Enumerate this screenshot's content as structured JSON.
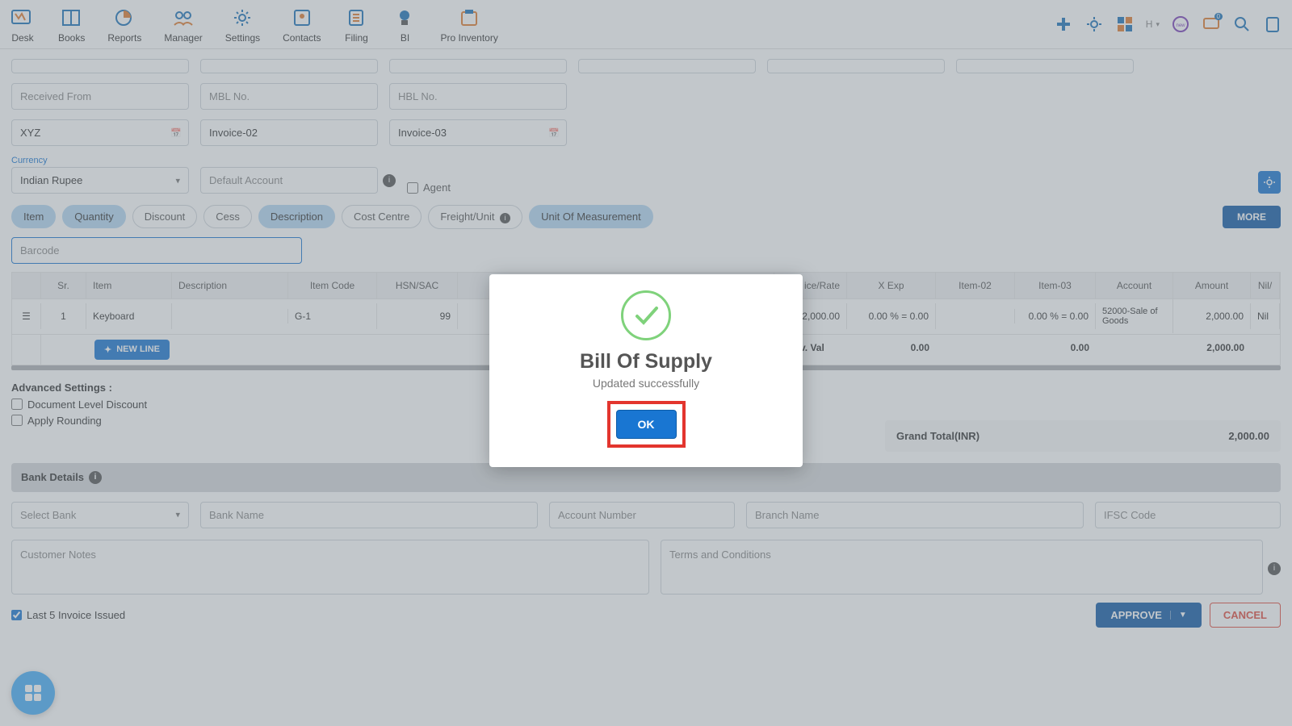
{
  "nav": {
    "items": [
      {
        "label": "Desk"
      },
      {
        "label": "Books"
      },
      {
        "label": "Reports"
      },
      {
        "label": "Manager"
      },
      {
        "label": "Settings"
      },
      {
        "label": "Contacts"
      },
      {
        "label": "Filing"
      },
      {
        "label": "BI"
      },
      {
        "label": "Pro Inventory"
      }
    ],
    "notif_count": "0",
    "h_label": "H"
  },
  "form": {
    "received_from": "Received From",
    "mbl": "MBL No.",
    "hbl": "HBL No.",
    "xyz": "XYZ",
    "inv2": "Invoice-02",
    "inv3": "Invoice-03",
    "currency_label": "Currency",
    "currency_val": "Indian Rupee",
    "default_acc": "Default Account",
    "agent": "Agent"
  },
  "pills": {
    "item": "Item",
    "qty": "Quantity",
    "disc": "Discount",
    "cess": "Cess",
    "desc": "Description",
    "cost": "Cost Centre",
    "freight": "Freight/Unit",
    "uom": "Unit Of Measurement",
    "more": "MORE"
  },
  "barcode_ph": "Barcode",
  "table": {
    "headers": {
      "sr": "Sr.",
      "item": "Item",
      "desc": "Description",
      "code": "Item Code",
      "hsn": "HSN/SAC",
      "rate": "ice/Rate",
      "xexp": "X Exp",
      "it2": "Item-02",
      "it3": "Item-03",
      "acc": "Account",
      "amt": "Amount",
      "nil": "Nil/"
    },
    "row": {
      "sr": "1",
      "item": "Keyboard",
      "code": "G-1",
      "hsn": "99",
      "rate": "2,000.00",
      "xexp": "0.00 % = 0.00",
      "it3": "0.00 % = 0.00",
      "acc": "52000-Sale of Goods",
      "amt": "2,000.00",
      "nil": "Nil"
    },
    "footer": {
      "label": "al Inv. Val",
      "v1": "0.00",
      "v2": "0.00",
      "amt": "2,000.00"
    },
    "newline": "NEW LINE"
  },
  "adv": {
    "title": "Advanced Settings :",
    "doc_disc": "Document Level Discount",
    "round": "Apply Rounding",
    "gt_label": "Grand Total(INR)",
    "gt_val": "2,000.00"
  },
  "bank": {
    "title": "Bank Details",
    "select": "Select Bank",
    "name": "Bank Name",
    "acc": "Account Number",
    "branch": "Branch Name",
    "ifsc": "IFSC Code",
    "notes": "Customer Notes",
    "terms": "Terms and Conditions"
  },
  "footer": {
    "approve": "APPROVE",
    "cancel": "CANCEL",
    "last5": "Last 5 Invoice Issued"
  },
  "modal": {
    "title": "Bill Of Supply",
    "msg": "Updated successfully",
    "ok": "OK"
  }
}
